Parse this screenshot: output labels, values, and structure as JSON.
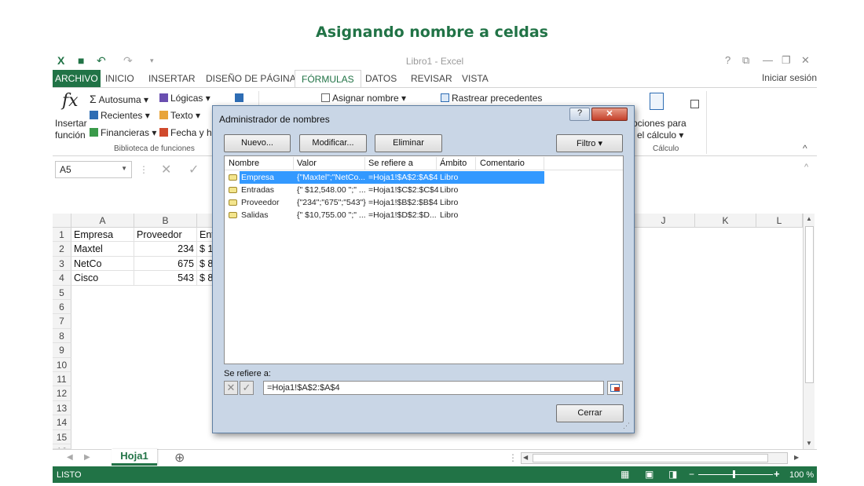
{
  "slide_title": "Asignando nombre a celdas",
  "window": {
    "title": "Libro1 - Excel",
    "signin": "Iniciar sesión",
    "controls": [
      "?",
      "⧉",
      "—",
      "❐",
      "✕"
    ]
  },
  "tabs": [
    "ARCHIVO",
    "INICIO",
    "INSERTAR",
    "DISEÑO DE PÁGINA",
    "FÓRMULAS",
    "DATOS",
    "REVISAR",
    "VISTA"
  ],
  "ribbon": {
    "insert_function": [
      "Insertar",
      "función"
    ],
    "fx": "fx",
    "autosuma": "Autosuma ▾",
    "recientes": "Recientes ▾",
    "financieras": "Financieras ▾",
    "logicas": "Lógicas ▾",
    "texto": "Texto ▾",
    "fecha": "Fecha y ho",
    "group_biblioteca": "Biblioteca de funciones",
    "asignar_nombre": "Asignar nombre ▾",
    "rastrear": "Rastrear precedentes",
    "opciones_calc": [
      "pciones para",
      "el cálculo ▾"
    ],
    "group_calculo": "Cálculo",
    "collapse": "^"
  },
  "namebox": "A5",
  "formula_icons": {
    "cancel": "✕",
    "enter": "✓"
  },
  "columns_left": [
    "A",
    "B"
  ],
  "columns_right": [
    "J",
    "K",
    "L"
  ],
  "rows": [
    "1",
    "2",
    "3",
    "4",
    "5",
    "6",
    "7",
    "8",
    "9",
    "10",
    "11",
    "12",
    "13",
    "14",
    "15",
    "16"
  ],
  "cells": {
    "a1": "Empresa",
    "b1": "Proveedor",
    "c1": "Ent",
    "a2": "Maxtel",
    "b2": "234",
    "c2": "$ 1",
    "a3": "NetCo",
    "b3": "675",
    "c3": "$ 8",
    "a4": "Cisco",
    "b4": "543",
    "c4": "$ 8"
  },
  "sheet_tab": "Hoja1",
  "add_sheet": "⊕",
  "status": {
    "ready": "LISTO",
    "zoom": "100 %"
  },
  "dialog": {
    "title": "Administrador de nombres",
    "help": "?",
    "close": "✕",
    "buttons": {
      "nuevo": "Nuevo...",
      "modificar": "Modificar...",
      "eliminar": "Eliminar",
      "filtro": "Filtro ▾",
      "cerrar": "Cerrar"
    },
    "headers": [
      "Nombre",
      "Valor",
      "Se refiere a",
      "Ámbito",
      "Comentario"
    ],
    "rows": [
      {
        "nombre": "Empresa",
        "valor": "{\"Maxtel\";\"NetCo...",
        "ref": "=Hoja1!$A$2:$A$4",
        "ambito": "Libro",
        "selected": true
      },
      {
        "nombre": "Entradas",
        "valor": "{\" $12,548.00 \";\" ...",
        "ref": "=Hoja1!$C$2:$C$4",
        "ambito": "Libro",
        "selected": false
      },
      {
        "nombre": "Proveedor",
        "valor": "{\"234\";\"675\";\"543\"}",
        "ref": "=Hoja1!$B$2:$B$4",
        "ambito": "Libro",
        "selected": false
      },
      {
        "nombre": "Salidas",
        "valor": "{\" $10,755.00 \";\" ...",
        "ref": "=Hoja1!$D$2:$D...",
        "ambito": "Libro",
        "selected": false
      }
    ],
    "refers_label": "Se refiere a:",
    "refers_value": "=Hoja1!$A$2:$A$4"
  },
  "colors": {
    "excel_green": "#217346",
    "selection": "#3399ff",
    "dialog_bg": "#c9d6e6"
  }
}
